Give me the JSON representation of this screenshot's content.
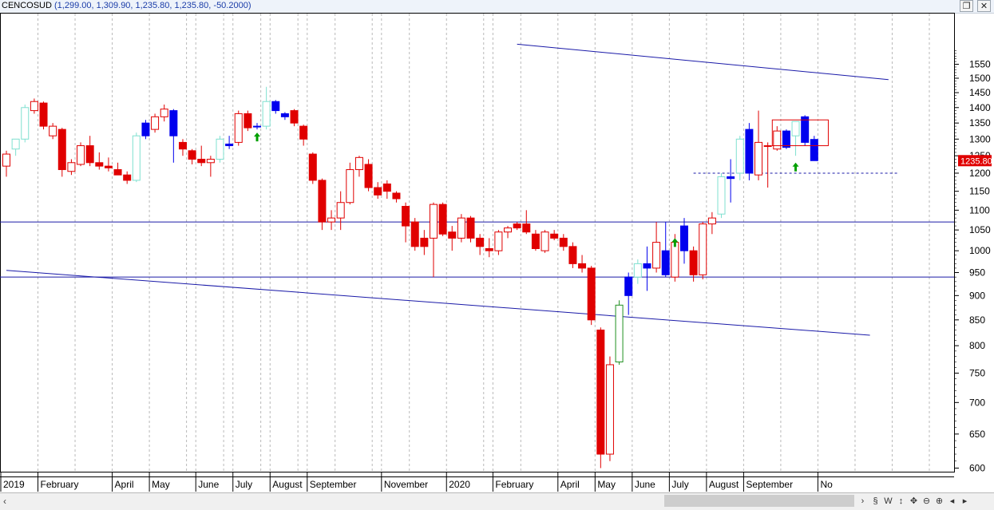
{
  "window": {
    "symbol": "CENCOSUD",
    "quote": "(1,299.00, 1,309.90, 1,235.80, 1,235.80, -50.2000)",
    "restore_icon": "restore-window-icon",
    "close_icon": "close-window-icon"
  },
  "price_badge": {
    "label": "1235.80",
    "value": 1235.8,
    "color": "#e00000"
  },
  "chart_data": {
    "type": "candlestick",
    "title": "CENCOSUD",
    "y_scale": "log",
    "ylim": [
      560,
      1620
    ],
    "y_ticks": [
      600,
      650,
      700,
      750,
      800,
      850,
      900,
      950,
      1000,
      1050,
      1100,
      1150,
      1200,
      1250,
      1300,
      1350,
      1400,
      1450,
      1500,
      1550
    ],
    "x_period_labels": [
      {
        "label": "2019",
        "bar": 0
      },
      {
        "label": "February",
        "bar": 4
      },
      {
        "label": "April",
        "bar": 12
      },
      {
        "label": "May",
        "bar": 16
      },
      {
        "label": "June",
        "bar": 21
      },
      {
        "label": "July",
        "bar": 25
      },
      {
        "label": "August",
        "bar": 29
      },
      {
        "label": "September",
        "bar": 33
      },
      {
        "label": "November",
        "bar": 41
      },
      {
        "label": "2020",
        "bar": 48
      },
      {
        "label": "February",
        "bar": 53
      },
      {
        "label": "April",
        "bar": 60
      },
      {
        "label": "May",
        "bar": 64
      },
      {
        "label": "June",
        "bar": 68
      },
      {
        "label": "July",
        "bar": 72
      },
      {
        "label": "August",
        "bar": 76
      },
      {
        "label": "September",
        "bar": 80
      },
      {
        "label": "No",
        "bar": 88
      }
    ],
    "colors": {
      "down": "#e00000",
      "up": "#ffffff",
      "up_edge": "#e00000",
      "blue": "#0000ee",
      "cyan_edge": "#7fe0d0",
      "green_edge": "#209020",
      "trendline": "#1a1aa8",
      "arrow": "#00a000"
    },
    "candles": [
      {
        "o": 1220,
        "h": 1265,
        "l": 1190,
        "c": 1255,
        "style": "up"
      },
      {
        "o": 1270,
        "h": 1300,
        "l": 1250,
        "c": 1300,
        "style": "cyan"
      },
      {
        "o": 1300,
        "h": 1410,
        "l": 1290,
        "c": 1400,
        "style": "cyan"
      },
      {
        "o": 1390,
        "h": 1430,
        "l": 1380,
        "c": 1420,
        "style": "up"
      },
      {
        "o": 1415,
        "h": 1420,
        "l": 1330,
        "c": 1340,
        "style": "down"
      },
      {
        "o": 1310,
        "h": 1350,
        "l": 1300,
        "c": 1340,
        "style": "up"
      },
      {
        "o": 1330,
        "h": 1335,
        "l": 1190,
        "c": 1210,
        "style": "down"
      },
      {
        "o": 1205,
        "h": 1240,
        "l": 1195,
        "c": 1230,
        "style": "up"
      },
      {
        "o": 1225,
        "h": 1290,
        "l": 1220,
        "c": 1280,
        "style": "up"
      },
      {
        "o": 1280,
        "h": 1310,
        "l": 1220,
        "c": 1230,
        "style": "down"
      },
      {
        "o": 1230,
        "h": 1260,
        "l": 1210,
        "c": 1220,
        "style": "down"
      },
      {
        "o": 1220,
        "h": 1245,
        "l": 1205,
        "c": 1215,
        "style": "down"
      },
      {
        "o": 1210,
        "h": 1230,
        "l": 1195,
        "c": 1195,
        "style": "down"
      },
      {
        "o": 1195,
        "h": 1205,
        "l": 1170,
        "c": 1180,
        "style": "down"
      },
      {
        "o": 1180,
        "h": 1320,
        "l": 1175,
        "c": 1310,
        "style": "cyan"
      },
      {
        "o": 1310,
        "h": 1360,
        "l": 1300,
        "c": 1350,
        "style": "blue"
      },
      {
        "o": 1330,
        "h": 1380,
        "l": 1320,
        "c": 1370,
        "style": "up"
      },
      {
        "o": 1370,
        "h": 1410,
        "l": 1355,
        "c": 1395,
        "style": "up"
      },
      {
        "o": 1390,
        "h": 1395,
        "l": 1230,
        "c": 1310,
        "style": "blue"
      },
      {
        "o": 1290,
        "h": 1300,
        "l": 1250,
        "c": 1270,
        "style": "down"
      },
      {
        "o": 1265,
        "h": 1270,
        "l": 1225,
        "c": 1240,
        "style": "down"
      },
      {
        "o": 1240,
        "h": 1280,
        "l": 1220,
        "c": 1230,
        "style": "down"
      },
      {
        "o": 1230,
        "h": 1250,
        "l": 1190,
        "c": 1240,
        "style": "up"
      },
      {
        "o": 1240,
        "h": 1310,
        "l": 1230,
        "c": 1300,
        "style": "cyan"
      },
      {
        "o": 1285,
        "h": 1310,
        "l": 1270,
        "c": 1280,
        "style": "blue"
      },
      {
        "o": 1290,
        "h": 1390,
        "l": 1280,
        "c": 1380,
        "style": "up"
      },
      {
        "o": 1380,
        "h": 1390,
        "l": 1325,
        "c": 1335,
        "style": "down"
      },
      {
        "o": 1340,
        "h": 1350,
        "l": 1330,
        "c": 1340,
        "style": "blue"
      },
      {
        "o": 1340,
        "h": 1470,
        "l": 1330,
        "c": 1420,
        "style": "cyan"
      },
      {
        "o": 1420,
        "h": 1425,
        "l": 1380,
        "c": 1390,
        "style": "blue"
      },
      {
        "o": 1380,
        "h": 1385,
        "l": 1360,
        "c": 1370,
        "style": "blue"
      },
      {
        "o": 1390,
        "h": 1395,
        "l": 1340,
        "c": 1350,
        "style": "down"
      },
      {
        "o": 1340,
        "h": 1345,
        "l": 1280,
        "c": 1300,
        "style": "down"
      },
      {
        "o": 1255,
        "h": 1260,
        "l": 1170,
        "c": 1180,
        "style": "down"
      },
      {
        "o": 1180,
        "h": 1185,
        "l": 1050,
        "c": 1070,
        "style": "down"
      },
      {
        "o": 1070,
        "h": 1100,
        "l": 1050,
        "c": 1080,
        "style": "up"
      },
      {
        "o": 1080,
        "h": 1150,
        "l": 1050,
        "c": 1120,
        "style": "up"
      },
      {
        "o": 1120,
        "h": 1230,
        "l": 1115,
        "c": 1210,
        "style": "up"
      },
      {
        "o": 1210,
        "h": 1250,
        "l": 1190,
        "c": 1245,
        "style": "up"
      },
      {
        "o": 1225,
        "h": 1240,
        "l": 1150,
        "c": 1160,
        "style": "down"
      },
      {
        "o": 1160,
        "h": 1175,
        "l": 1130,
        "c": 1140,
        "style": "down"
      },
      {
        "o": 1170,
        "h": 1180,
        "l": 1130,
        "c": 1150,
        "style": "down"
      },
      {
        "o": 1145,
        "h": 1150,
        "l": 1120,
        "c": 1130,
        "style": "down"
      },
      {
        "o": 1110,
        "h": 1120,
        "l": 1020,
        "c": 1060,
        "style": "down"
      },
      {
        "o": 1070,
        "h": 1080,
        "l": 1000,
        "c": 1010,
        "style": "down"
      },
      {
        "o": 1010,
        "h": 1050,
        "l": 990,
        "c": 1030,
        "style": "down"
      },
      {
        "o": 1030,
        "h": 1120,
        "l": 940,
        "c": 1115,
        "style": "up"
      },
      {
        "o": 1115,
        "h": 1120,
        "l": 1035,
        "c": 1040,
        "style": "down"
      },
      {
        "o": 1045,
        "h": 1060,
        "l": 1000,
        "c": 1030,
        "style": "down"
      },
      {
        "o": 1030,
        "h": 1090,
        "l": 1020,
        "c": 1080,
        "style": "up"
      },
      {
        "o": 1080,
        "h": 1085,
        "l": 1020,
        "c": 1030,
        "style": "down"
      },
      {
        "o": 1030,
        "h": 1040,
        "l": 990,
        "c": 1010,
        "style": "down"
      },
      {
        "o": 1005,
        "h": 1030,
        "l": 985,
        "c": 1000,
        "style": "down"
      },
      {
        "o": 1000,
        "h": 1050,
        "l": 990,
        "c": 1045,
        "style": "up"
      },
      {
        "o": 1045,
        "h": 1060,
        "l": 1030,
        "c": 1055,
        "style": "up"
      },
      {
        "o": 1055,
        "h": 1070,
        "l": 1050,
        "c": 1065,
        "style": "down"
      },
      {
        "o": 1065,
        "h": 1100,
        "l": 1040,
        "c": 1045,
        "style": "down"
      },
      {
        "o": 1040,
        "h": 1050,
        "l": 1000,
        "c": 1005,
        "style": "down"
      },
      {
        "o": 1000,
        "h": 1050,
        "l": 995,
        "c": 1045,
        "style": "up"
      },
      {
        "o": 1040,
        "h": 1050,
        "l": 1025,
        "c": 1030,
        "style": "down"
      },
      {
        "o": 1030,
        "h": 1040,
        "l": 1000,
        "c": 1010,
        "style": "down"
      },
      {
        "o": 1010,
        "h": 1020,
        "l": 960,
        "c": 970,
        "style": "down"
      },
      {
        "o": 970,
        "h": 990,
        "l": 950,
        "c": 960,
        "style": "down"
      },
      {
        "o": 960,
        "h": 965,
        "l": 840,
        "c": 850,
        "style": "down"
      },
      {
        "o": 830,
        "h": 835,
        "l": 600,
        "c": 620,
        "style": "down"
      },
      {
        "o": 620,
        "h": 780,
        "l": 610,
        "c": 765,
        "style": "up"
      },
      {
        "o": 770,
        "h": 890,
        "l": 765,
        "c": 880,
        "style": "green"
      },
      {
        "o": 900,
        "h": 950,
        "l": 860,
        "c": 940,
        "style": "blue"
      },
      {
        "o": 940,
        "h": 980,
        "l": 925,
        "c": 970,
        "style": "cyan"
      },
      {
        "o": 970,
        "h": 1010,
        "l": 910,
        "c": 960,
        "style": "blue"
      },
      {
        "o": 960,
        "h": 1070,
        "l": 950,
        "c": 1020,
        "style": "up"
      },
      {
        "o": 1000,
        "h": 1070,
        "l": 940,
        "c": 945,
        "style": "blue"
      },
      {
        "o": 940,
        "h": 1040,
        "l": 930,
        "c": 1020,
        "style": "up"
      },
      {
        "o": 1000,
        "h": 1080,
        "l": 970,
        "c": 1060,
        "style": "blue"
      },
      {
        "o": 1000,
        "h": 1010,
        "l": 930,
        "c": 945,
        "style": "down"
      },
      {
        "o": 945,
        "h": 1070,
        "l": 935,
        "c": 1065,
        "style": "up"
      },
      {
        "o": 1065,
        "h": 1095,
        "l": 1040,
        "c": 1080,
        "style": "up"
      },
      {
        "o": 1090,
        "h": 1200,
        "l": 1080,
        "c": 1190,
        "style": "cyan"
      },
      {
        "o": 1185,
        "h": 1240,
        "l": 1120,
        "c": 1190,
        "style": "blue"
      },
      {
        "o": 1200,
        "h": 1310,
        "l": 1180,
        "c": 1300,
        "style": "cyan"
      },
      {
        "o": 1200,
        "h": 1350,
        "l": 1180,
        "c": 1330,
        "style": "blue"
      },
      {
        "o": 1195,
        "h": 1390,
        "l": 1180,
        "c": 1290,
        "style": "up"
      },
      {
        "o": 1280,
        "h": 1290,
        "l": 1160,
        "c": 1280,
        "style": "down"
      },
      {
        "o": 1270,
        "h": 1340,
        "l": 1265,
        "c": 1325,
        "style": "up"
      },
      {
        "o": 1275,
        "h": 1330,
        "l": 1270,
        "c": 1325,
        "style": "blue"
      },
      {
        "o": 1310,
        "h": 1350,
        "l": 1250,
        "c": 1355,
        "style": "cyan"
      },
      {
        "o": 1370,
        "h": 1375,
        "l": 1280,
        "c": 1290,
        "style": "blue"
      },
      {
        "o": 1299,
        "h": 1309.9,
        "l": 1235.8,
        "c": 1235.8,
        "style": "blue"
      }
    ],
    "horizontal_lines": [
      1070,
      940
    ],
    "dashed_line": {
      "from_bar": 74,
      "to_bar": 96,
      "value": 1200
    },
    "trendlines": [
      {
        "from_bar": 55,
        "from_value": 1625,
        "to_bar": 95,
        "to_value": 1495
      },
      {
        "from_bar": 0,
        "from_value": 955,
        "to_bar": 93,
        "to_value": 820
      }
    ],
    "highlight_box": {
      "from_bar": 83,
      "to_bar": 88,
      "low": 1280,
      "high": 1360
    },
    "arrows": [
      {
        "bar": 27,
        "value": 1320
      },
      {
        "bar": 72,
        "value": 1030
      },
      {
        "bar": 85,
        "value": 1230
      }
    ]
  },
  "statusbar": {
    "nav_icons": [
      "chevron-right-icon",
      "link-icon",
      "w-icon",
      "move-vertical-icon",
      "move-icon",
      "zoom-out-icon",
      "zoom-in-icon",
      "chevron-left-icon",
      "chevron-right-icon"
    ]
  }
}
